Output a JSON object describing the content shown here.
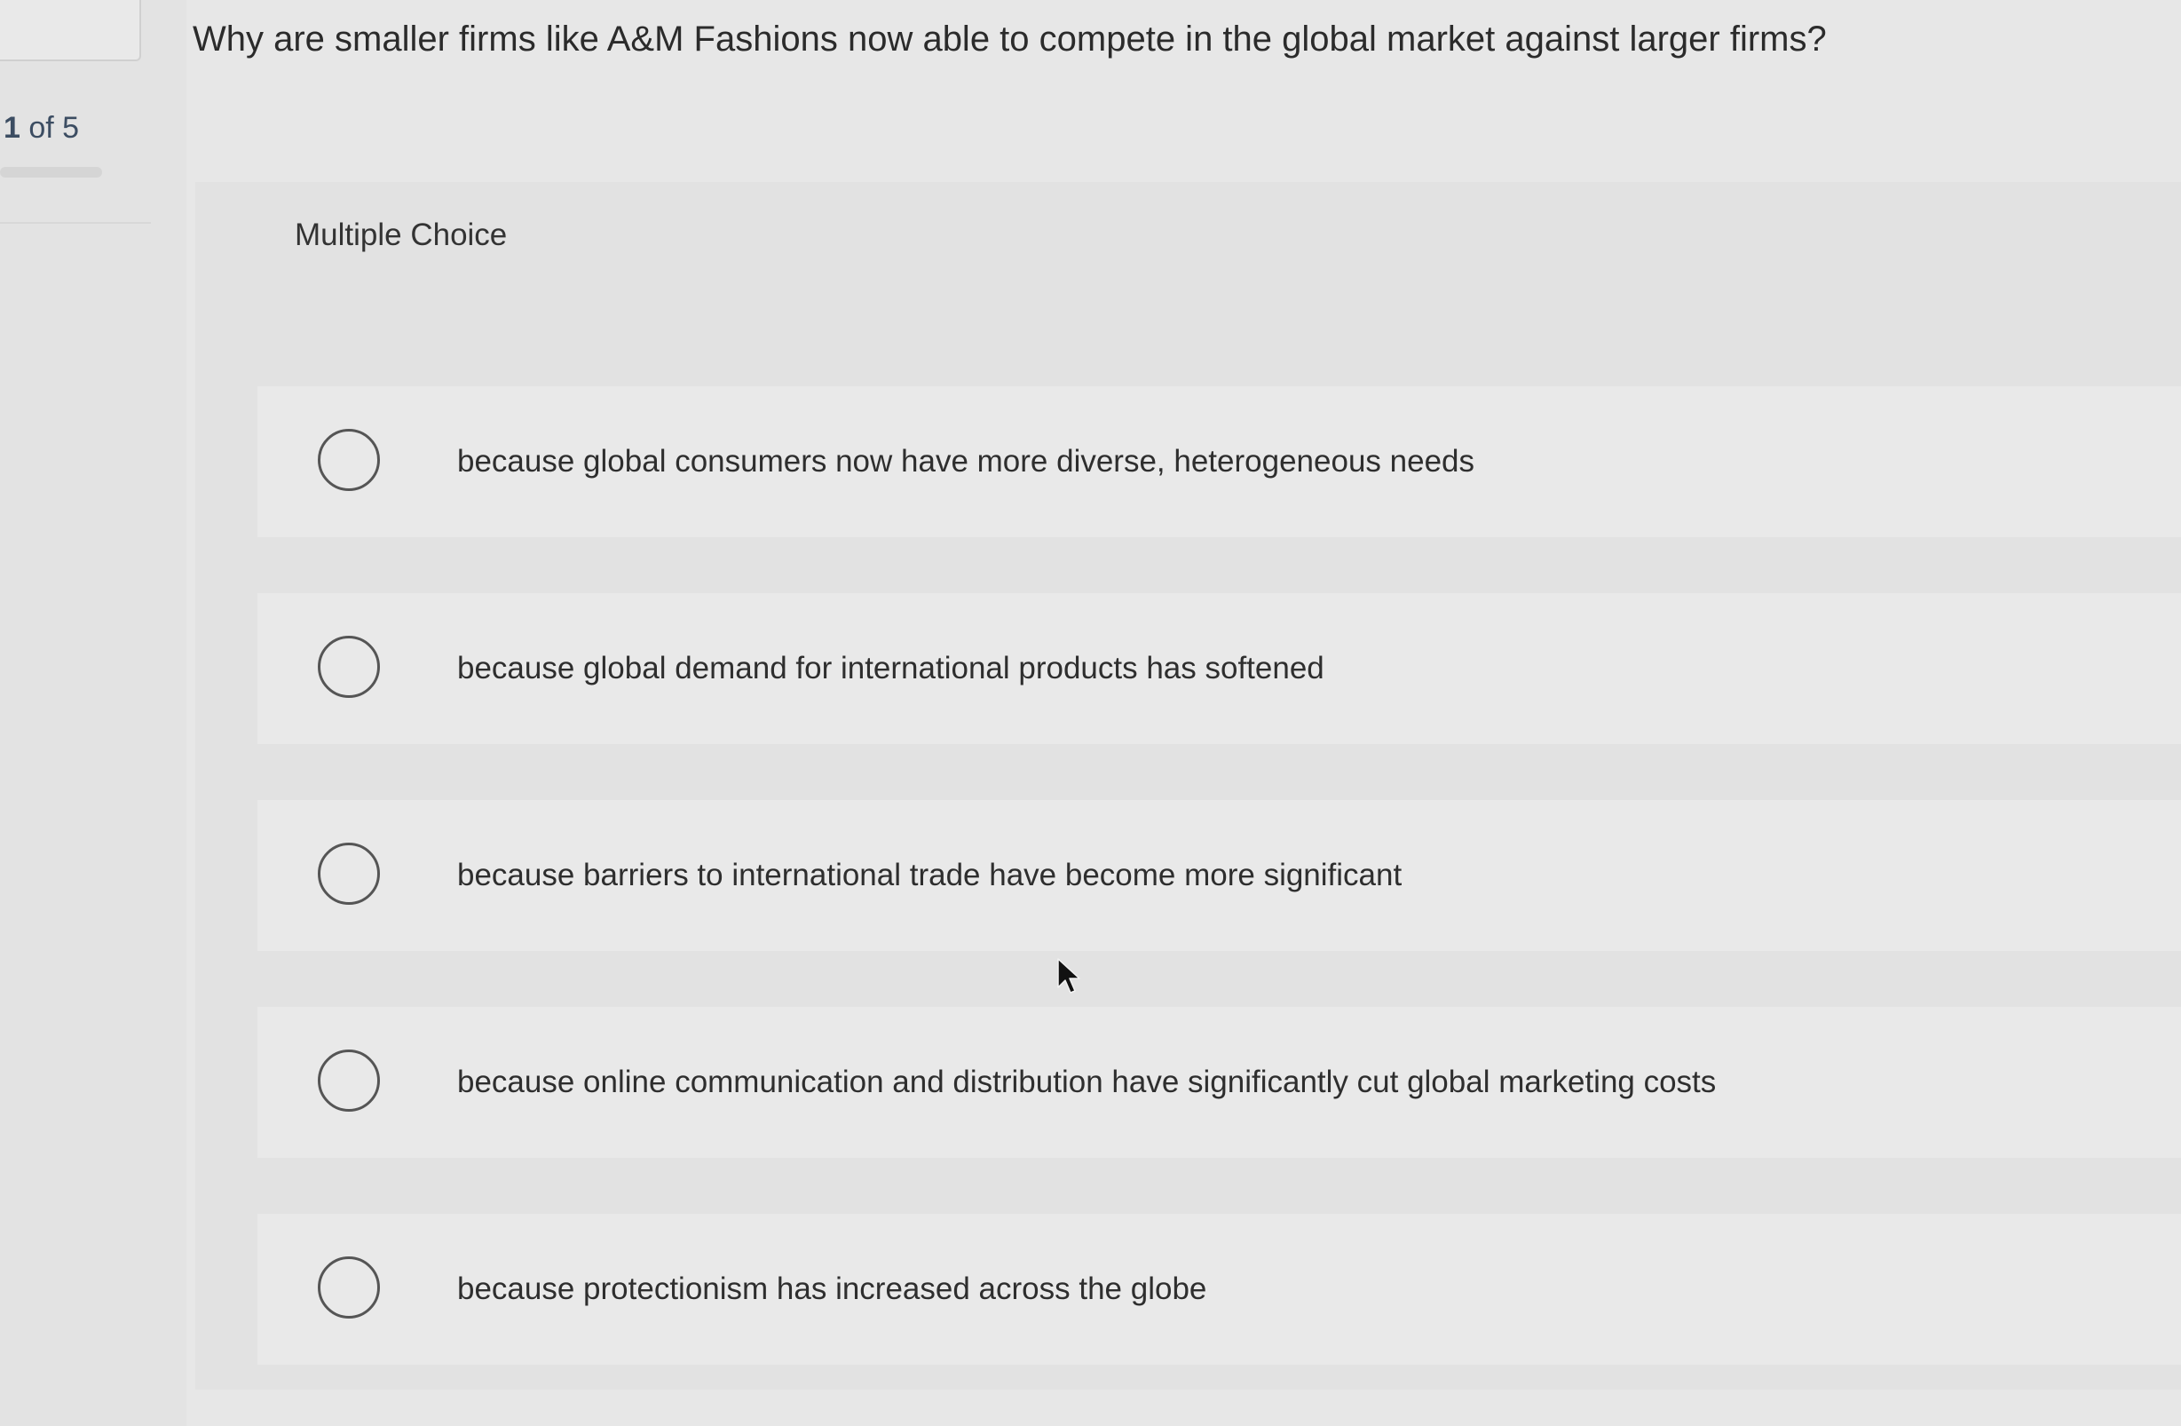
{
  "progress": {
    "current": "1",
    "of_total": "of 5"
  },
  "question": {
    "text": "Why are smaller firms like A&M Fashions now able to compete in the global market against larger firms?"
  },
  "panel": {
    "title": "Multiple Choice"
  },
  "options": [
    {
      "label": "because global consumers now have more diverse, heterogeneous needs",
      "selected": false
    },
    {
      "label": "because global demand for international products has softened",
      "selected": false
    },
    {
      "label": "because barriers to international trade have become more significant",
      "selected": false
    },
    {
      "label": "because online communication and distribution have significantly cut global marketing costs",
      "selected": false
    },
    {
      "label": "because protectionism has increased across the globe",
      "selected": false
    }
  ]
}
